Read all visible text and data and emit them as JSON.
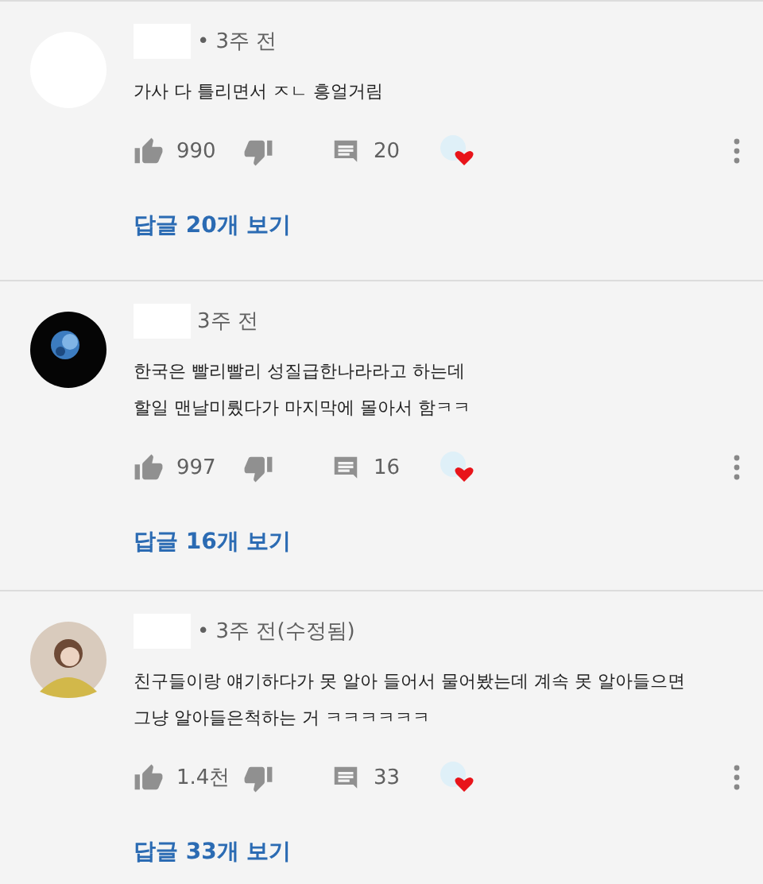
{
  "comments": [
    {
      "avatar": {
        "kind": "blank"
      },
      "time": "• 3주 전",
      "lines": [
        "가사 다 틀리면서 ㅈㄴ 흥얼거림"
      ],
      "likes": "990",
      "replies": "20",
      "hearted": true,
      "view_replies": "답글 20개 보기"
    },
    {
      "avatar": {
        "kind": "picture"
      },
      "time": "3주 전",
      "lines": [
        "한국은 빨리빨리 성질급한나라라고 하는데",
        "할일 맨날미뤘다가 마지막에 몰아서 함ㅋㅋ"
      ],
      "likes": "997",
      "replies": "16",
      "hearted": true,
      "view_replies": "답글 16개 보기"
    },
    {
      "avatar": {
        "kind": "person"
      },
      "time": "• 3주 전(수정됨)",
      "lines": [
        "친구들이랑 얘기하다가 못 알아 들어서 물어봤는데 계속 못 알아들으면",
        "그냥 알아들은척하는 거 ㅋㅋㅋㅋㅋㅋ"
      ],
      "likes": "1.4천",
      "replies": "33",
      "hearted": true,
      "view_replies": "답글 33개 보기"
    }
  ]
}
